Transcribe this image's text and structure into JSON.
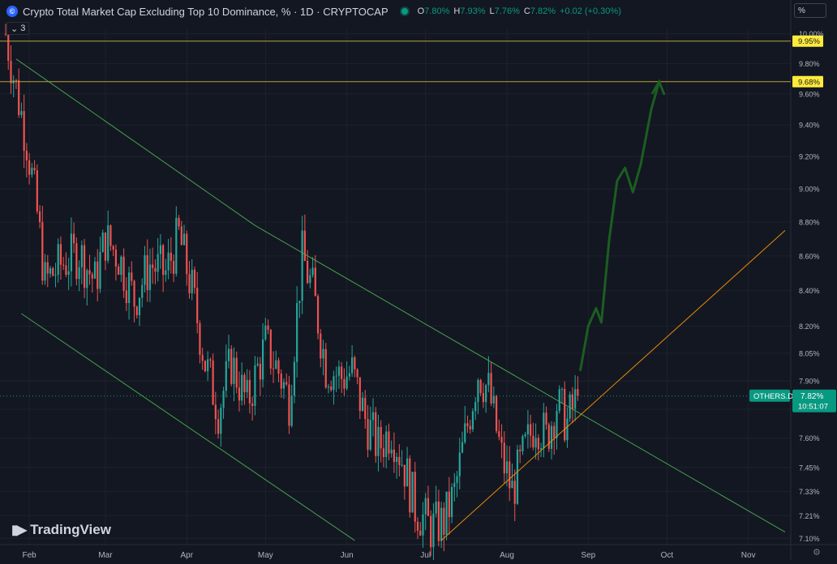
{
  "header": {
    "symbol_icon": "currency-icon",
    "title": "Crypto Total Market Cap Excluding Top 10 Dominance, % · 1D · CRYPTOCAP",
    "ohlc": [
      {
        "k": "O",
        "v": "7.80%"
      },
      {
        "k": "H",
        "v": "7.93%"
      },
      {
        "k": "L",
        "v": "7.76%"
      },
      {
        "k": "C",
        "v": "7.82%"
      },
      {
        "k": "",
        "v": "+0.02 (+0.30%)"
      }
    ],
    "indicator_count": "3",
    "scale_mode": "%"
  },
  "price_label": {
    "ticker": "OTHERS.D",
    "value": "7.82%",
    "countdown": "10:51:07"
  },
  "logo": "TradingView",
  "colors": {
    "background": "#131722",
    "up": "#26a69a",
    "down": "#ef5350",
    "trend_green": "#4caf50",
    "trend_orange": "#ff9800",
    "projection": "#1b5e20",
    "level_label": "#ffeb3b",
    "price_badge": "#089981"
  },
  "chart_data": {
    "type": "candlestick",
    "title": "Crypto Total Market Cap Excluding Top 10 Dominance, % · 1D · CRYPTOCAP",
    "y_axis": {
      "ticks": [
        "10.00%",
        "9.80%",
        "9.60%",
        "9.40%",
        "9.20%",
        "9.00%",
        "8.80%",
        "8.60%",
        "8.40%",
        "8.20%",
        "8.05%",
        "7.90%",
        "7.75%",
        "7.60%",
        "7.45%",
        "7.33%",
        "7.21%",
        "7.10%"
      ],
      "log_scale": true,
      "range": [
        7.07,
        10.02
      ]
    },
    "x_axis": {
      "ticks": [
        "Feb",
        "Mar",
        "Apr",
        "May",
        "Jun",
        "Jul",
        "Aug",
        "Sep",
        "Oct",
        "Nov"
      ],
      "range": [
        "2024-01-23",
        "2024-11-15"
      ]
    },
    "horizontal_levels": [
      {
        "value": 9.95,
        "label": "9.95%"
      },
      {
        "value": 9.68,
        "label": "9.68%"
      }
    ],
    "current_price": 7.82,
    "anchors": [
      {
        "date": "2024-01-23",
        "close": 10.0
      },
      {
        "date": "2024-01-26",
        "close": 9.72
      },
      {
        "date": "2024-01-31",
        "close": 9.3
      },
      {
        "date": "2024-02-04",
        "close": 8.85
      },
      {
        "date": "2024-02-07",
        "close": 8.45
      },
      {
        "date": "2024-02-13",
        "close": 8.55
      },
      {
        "date": "2024-02-20",
        "close": 8.62
      },
      {
        "date": "2024-02-26",
        "close": 8.45
      },
      {
        "date": "2024-03-01",
        "close": 8.7
      },
      {
        "date": "2024-03-06",
        "close": 8.6
      },
      {
        "date": "2024-03-12",
        "close": 8.35
      },
      {
        "date": "2024-03-18",
        "close": 8.55
      },
      {
        "date": "2024-03-24",
        "close": 8.5
      },
      {
        "date": "2024-03-29",
        "close": 8.72
      },
      {
        "date": "2024-04-03",
        "close": 8.4
      },
      {
        "date": "2024-04-08",
        "close": 8.0
      },
      {
        "date": "2024-04-13",
        "close": 7.75
      },
      {
        "date": "2024-04-18",
        "close": 8.0
      },
      {
        "date": "2024-04-24",
        "close": 7.78
      },
      {
        "date": "2024-05-01",
        "close": 8.1
      },
      {
        "date": "2024-05-06",
        "close": 7.95
      },
      {
        "date": "2024-05-10",
        "close": 7.8
      },
      {
        "date": "2024-05-15",
        "close": 8.6
      },
      {
        "date": "2024-05-19",
        "close": 8.4
      },
      {
        "date": "2024-05-24",
        "close": 7.98
      },
      {
        "date": "2024-05-30",
        "close": 7.92
      },
      {
        "date": "2024-06-03",
        "close": 7.95
      },
      {
        "date": "2024-06-08",
        "close": 7.7
      },
      {
        "date": "2024-06-13",
        "close": 7.55
      },
      {
        "date": "2024-06-18",
        "close": 7.65
      },
      {
        "date": "2024-06-23",
        "close": 7.45
      },
      {
        "date": "2024-06-27",
        "close": 7.25
      },
      {
        "date": "2024-07-03",
        "close": 7.15
      },
      {
        "date": "2024-07-08",
        "close": 7.18
      },
      {
        "date": "2024-07-12",
        "close": 7.32
      },
      {
        "date": "2024-07-16",
        "close": 7.6
      },
      {
        "date": "2024-07-21",
        "close": 7.95
      },
      {
        "date": "2024-07-25",
        "close": 7.85
      },
      {
        "date": "2024-07-30",
        "close": 7.5
      },
      {
        "date": "2024-08-03",
        "close": 7.33
      },
      {
        "date": "2024-08-07",
        "close": 7.5
      },
      {
        "date": "2024-08-12",
        "close": 7.7
      },
      {
        "date": "2024-08-16",
        "close": 7.6
      },
      {
        "date": "2024-08-20",
        "close": 7.78
      },
      {
        "date": "2024-08-24",
        "close": 7.68
      },
      {
        "date": "2024-08-28",
        "close": 7.82
      }
    ],
    "trendlines": [
      {
        "name": "channel-upper",
        "color": "green",
        "points": [
          [
            "2024-01-27",
            9.83
          ],
          [
            "2024-04-27",
            8.78
          ],
          [
            "2024-11-15",
            7.13
          ]
        ]
      },
      {
        "name": "channel-lower",
        "color": "green",
        "points": [
          [
            "2024-01-29",
            8.27
          ],
          [
            "2024-06-04",
            7.09
          ]
        ]
      },
      {
        "name": "rising-support",
        "color": "orange",
        "points": [
          [
            "2024-07-07",
            7.09
          ],
          [
            "2024-11-15",
            8.75
          ]
        ]
      }
    ],
    "projection_path": [
      [
        "2024-08-29",
        7.96
      ],
      [
        "2024-09-01",
        8.2
      ],
      [
        "2024-09-04",
        8.3
      ],
      [
        "2024-09-06",
        8.22
      ],
      [
        "2024-09-09",
        8.7
      ],
      [
        "2024-09-12",
        9.05
      ],
      [
        "2024-09-15",
        9.13
      ],
      [
        "2024-09-18",
        8.98
      ],
      [
        "2024-09-21",
        9.15
      ],
      [
        "2024-09-25",
        9.5
      ],
      [
        "2024-09-28",
        9.68
      ]
    ]
  }
}
